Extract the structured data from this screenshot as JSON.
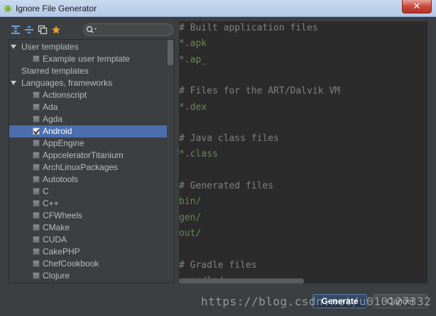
{
  "window": {
    "title": "Ignore File Generator",
    "close_symbol": "✕"
  },
  "toolbar": {
    "icons": [
      "expand-all-icon",
      "collapse-all-icon",
      "copy-icon",
      "star-icon"
    ],
    "search": {
      "value": "",
      "placeholder": ""
    }
  },
  "tree": {
    "rows": [
      {
        "type": "group",
        "label": "User templates",
        "expanded": true
      },
      {
        "type": "item",
        "label": "Example user template",
        "checked": false
      },
      {
        "type": "group",
        "label": "Starred templates",
        "expanded": false
      },
      {
        "type": "group",
        "label": "Languages, frameworks",
        "expanded": true
      },
      {
        "type": "item",
        "label": "Actionscript",
        "checked": false
      },
      {
        "type": "item",
        "label": "Ada",
        "checked": false
      },
      {
        "type": "item",
        "label": "Agda",
        "checked": false
      },
      {
        "type": "item",
        "label": "Android",
        "checked": true,
        "selected": true
      },
      {
        "type": "item",
        "label": "AppEngine",
        "checked": false
      },
      {
        "type": "item",
        "label": "AppceleratorTitanium",
        "checked": false
      },
      {
        "type": "item",
        "label": "ArchLinuxPackages",
        "checked": false
      },
      {
        "type": "item",
        "label": "Autotools",
        "checked": false
      },
      {
        "type": "item",
        "label": "C",
        "checked": false
      },
      {
        "type": "item",
        "label": "C++",
        "checked": false
      },
      {
        "type": "item",
        "label": "CFWheels",
        "checked": false
      },
      {
        "type": "item",
        "label": "CMake",
        "checked": false
      },
      {
        "type": "item",
        "label": "CUDA",
        "checked": false
      },
      {
        "type": "item",
        "label": "CakePHP",
        "checked": false
      },
      {
        "type": "item",
        "label": "ChefCookbook",
        "checked": false
      },
      {
        "type": "item",
        "label": "Clojure",
        "checked": false
      }
    ]
  },
  "editor": {
    "lines": [
      {
        "text": "# Built application files",
        "kind": "comment"
      },
      {
        "text": "*.apk",
        "kind": "pattern"
      },
      {
        "text": "*.ap_",
        "kind": "pattern"
      },
      {
        "text": "",
        "kind": "blank"
      },
      {
        "text": "# Files for the ART/Dalvik VM",
        "kind": "comment"
      },
      {
        "text": "*.dex",
        "kind": "pattern"
      },
      {
        "text": "",
        "kind": "blank"
      },
      {
        "text": "# Java class files",
        "kind": "comment"
      },
      {
        "text": "*.class",
        "kind": "pattern"
      },
      {
        "text": "",
        "kind": "blank"
      },
      {
        "text": "# Generated files",
        "kind": "comment"
      },
      {
        "text": "bin/",
        "kind": "pattern"
      },
      {
        "text": "gen/",
        "kind": "pattern"
      },
      {
        "text": "out/",
        "kind": "pattern"
      },
      {
        "text": "",
        "kind": "blank"
      },
      {
        "text": "# Gradle files",
        "kind": "comment"
      },
      {
        "text": ".gradle/",
        "kind": "pattern"
      }
    ],
    "colors": {
      "background": "#2b2b2b",
      "comment": "#808080",
      "pattern": "#6a8759"
    }
  },
  "buttons": {
    "generate": "Generate",
    "cancel": "Cancel"
  },
  "watermark": "https://blog.csdn.net/u010127332",
  "colors": {
    "panel": "#3c3f41",
    "selection": "#4b6eaf",
    "star": "#e8a032"
  }
}
